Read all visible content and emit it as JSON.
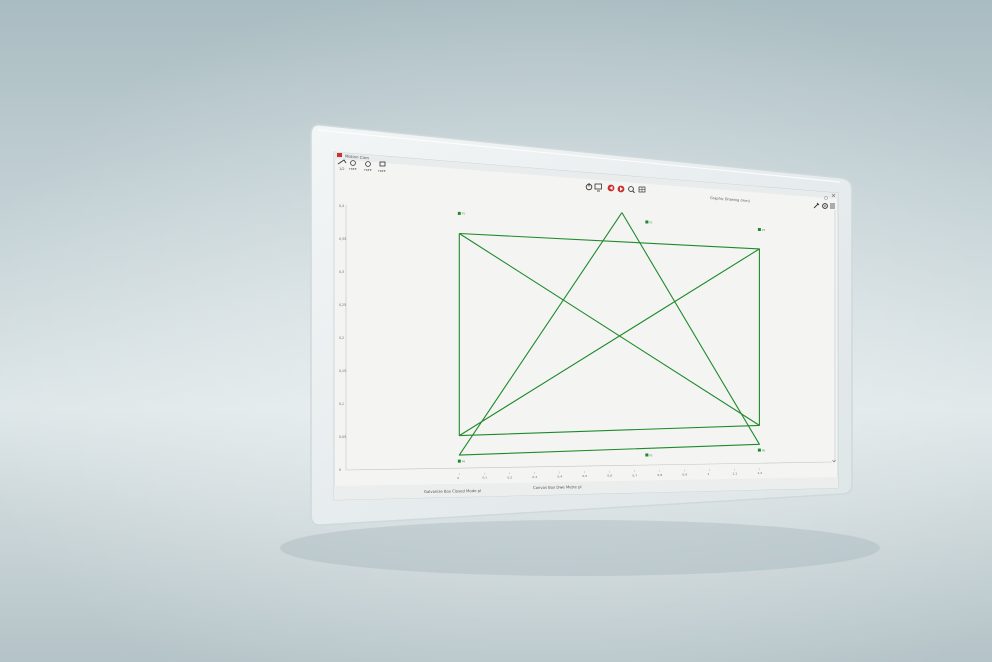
{
  "window": {
    "title": "Motion Cam",
    "toolbar_labels": [
      "1/2",
      "FREE",
      "FREE",
      "FREE"
    ],
    "status_text": "Graphic Drawing (mm)",
    "footer_left": "Galvanize Box Closed Mode pl",
    "footer_center": "Canvas Box Dwe Metre pl"
  },
  "icons": {
    "app": "app-logo-icon",
    "power": "power-icon",
    "monitor": "monitor-icon",
    "rewind": "rewind-icon",
    "play": "play-icon",
    "zoom": "zoom-icon",
    "grid": "grid-icon",
    "settings": "gear-icon",
    "wrench": "wrench-icon",
    "menu": "menu-icon",
    "help": "help-icon",
    "close": "close-icon"
  },
  "colors": {
    "accent": "#cc2f2f",
    "trace": "#1f8a2a",
    "canvas": "#f4f5f3",
    "glass": "#e9eeef"
  },
  "chart_data": {
    "type": "line",
    "xlabel": "",
    "ylabel": "",
    "xlim": [
      0,
      1.2
    ],
    "ylim": [
      0,
      0.4
    ],
    "x_ticks": [
      "0",
      "0,1",
      "0,2",
      "0,3",
      "0,4",
      "0,5",
      "0,6",
      "0,7",
      "0,8",
      "0,9",
      "1",
      "1,1",
      "1,2"
    ],
    "y_ticks": [
      "0",
      "0,05",
      "0,1",
      "0,15",
      "0,2",
      "0,25",
      "0,3",
      "0,35",
      "0,4"
    ],
    "series": [
      {
        "values": [
          [
            0.0,
            0.36
          ],
          [
            1.2,
            0.34
          ],
          [
            1.2,
            0.06
          ],
          [
            0.0,
            0.05
          ],
          [
            0.0,
            0.36
          ]
        ]
      },
      {
        "values": [
          [
            0.0,
            0.36
          ],
          [
            1.2,
            0.06
          ]
        ]
      },
      {
        "values": [
          [
            1.2,
            0.34
          ],
          [
            0.0,
            0.05
          ]
        ]
      },
      {
        "values": [
          [
            0.65,
            0.395
          ],
          [
            1.2,
            0.03
          ],
          [
            0.0,
            0.02
          ],
          [
            0.65,
            0.395
          ]
        ]
      }
    ],
    "point_markers": [
      {
        "label": "P1",
        "x": 0.0,
        "y": 0.39
      },
      {
        "label": "P2",
        "x": 0.75,
        "y": 0.38
      },
      {
        "label": "P3",
        "x": 1.2,
        "y": 0.37
      },
      {
        "label": "P4",
        "x": 0.0,
        "y": 0.01
      },
      {
        "label": "P5",
        "x": 0.75,
        "y": 0.015
      },
      {
        "label": "P6",
        "x": 1.2,
        "y": 0.02
      }
    ]
  }
}
